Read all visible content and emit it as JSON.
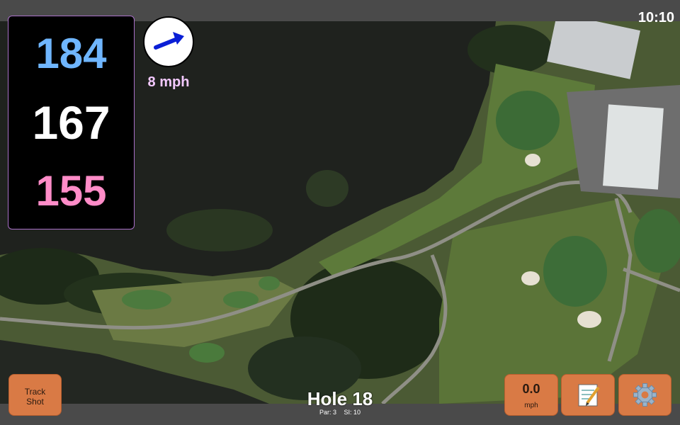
{
  "status": {
    "time": "10:10"
  },
  "distances": {
    "back": "184",
    "center": "167",
    "front": "155"
  },
  "wind": {
    "speed": "8 mph",
    "icon": "wind-arrow-icon"
  },
  "hole": {
    "title": "Hole 18",
    "par": "Par: 3",
    "si": "SI: 10"
  },
  "buttons": {
    "track_shot": "Track\nShot",
    "speed_value": "0.0",
    "speed_unit": "mph",
    "notes_icon": "notepad-icon",
    "settings_icon": "gear-icon"
  },
  "colors": {
    "back": "#6fb6ff",
    "center": "#ffffff",
    "front": "#ff8cc8",
    "button": "#d97a45",
    "wind_text": "#f3c9ff"
  }
}
